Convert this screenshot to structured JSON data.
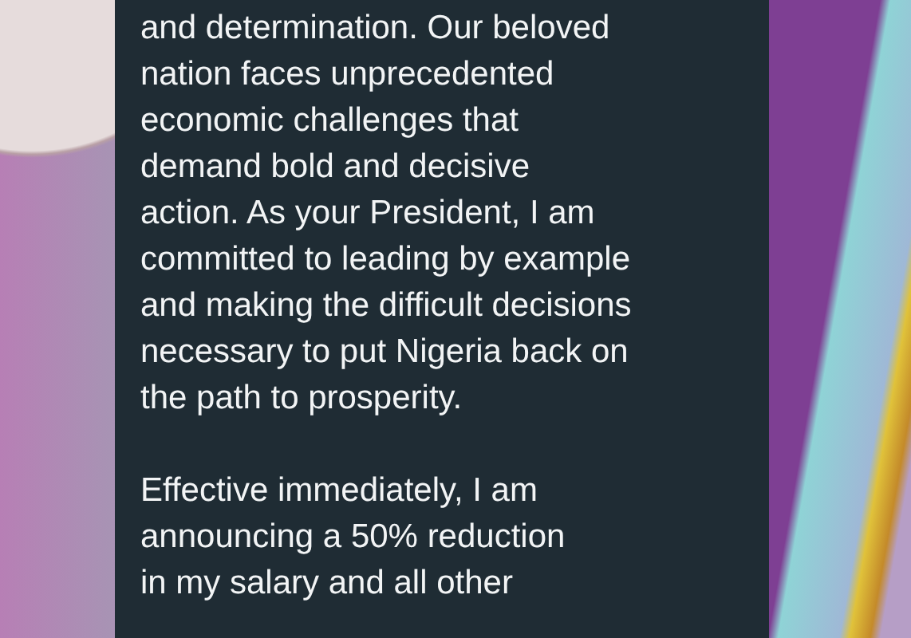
{
  "message": {
    "paragraphs": [
      {
        "lines": [
          "and determination. Our beloved",
          "nation faces unprecedented",
          "economic challenges that",
          "demand bold and decisive",
          "action. As your President, I am",
          "committed to leading by example",
          "and making the difficult decisions",
          "necessary to put Nigeria back on",
          "the path to prosperity."
        ]
      },
      {
        "lines": [
          "Effective immediately, I am",
          "announcing a 50% reduction",
          "in my salary and all other"
        ]
      }
    ]
  }
}
